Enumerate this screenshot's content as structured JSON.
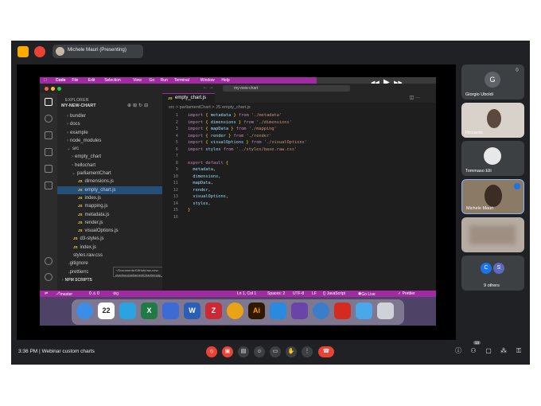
{
  "meeting": {
    "presenter_label": "Michele Mauri (Presenting)",
    "time": "3:36 PM",
    "title": "Webinar custom charts",
    "participants_badge": "13"
  },
  "participants": [
    {
      "name": "Giorgio Uboldi",
      "initial": "G",
      "avatar_color": "#5f6368"
    },
    {
      "name": "Riccardo",
      "initial": "",
      "avatar_color": ""
    },
    {
      "name": "Tommaso Elli",
      "initial": "",
      "avatar_color": ""
    },
    {
      "name": "Michele Mauri",
      "initial": "",
      "avatar_color": ""
    },
    {
      "name": "",
      "initial": "",
      "avatar_color": ""
    },
    {
      "name": "9 others",
      "initial": "C",
      "initial2": "S",
      "avatar_color": "#1a73e8",
      "avatar_color2": "#5c6bc0"
    }
  ],
  "mac_menu": [
    "Code",
    "File",
    "Edit",
    "Selection",
    "View",
    "Go",
    "Run",
    "Terminal",
    "Window",
    "Help"
  ],
  "player": {
    "elapsed": "03:24",
    "remaining": "18:57",
    "progress": 0.2
  },
  "vscode": {
    "command_center": "my-new-chart",
    "explorer_title": "EXPLORER",
    "project": "MY-NEW-CHART",
    "tree": [
      {
        "label": "bundler",
        "indent": 1,
        "js": false
      },
      {
        "label": "docs",
        "indent": 1,
        "js": false
      },
      {
        "label": "example",
        "indent": 1,
        "js": false
      },
      {
        "label": "node_modules",
        "indent": 1,
        "js": false
      },
      {
        "label": "src",
        "indent": 1,
        "js": false
      },
      {
        "label": "empty_chart",
        "indent": 2,
        "js": false
      },
      {
        "label": "hellochart",
        "indent": 2,
        "js": false
      },
      {
        "label": "parliamentChart",
        "indent": 2,
        "js": false
      },
      {
        "label": "dimensions.js",
        "indent": 3,
        "js": true
      },
      {
        "label": "empty_chart.js",
        "indent": 3,
        "js": true,
        "selected": true
      },
      {
        "label": "index.js",
        "indent": 3,
        "js": true
      },
      {
        "label": "mapping.js",
        "indent": 3,
        "js": true
      },
      {
        "label": "metadata.js",
        "indent": 3,
        "js": true
      },
      {
        "label": "render.js",
        "indent": 3,
        "js": true
      },
      {
        "label": "visualOptions.js",
        "indent": 3,
        "js": true
      },
      {
        "label": "d3-styles.js",
        "indent": 2,
        "js": true
      },
      {
        "label": "index.js",
        "indent": 2,
        "js": true
      },
      {
        "label": "styles.raw.css",
        "indent": 2,
        "js": false
      },
      {
        "label": ".gitignore",
        "indent": 1,
        "js": false
      },
      {
        "label": ".prettierrc",
        "indent": 1,
        "js": false
      },
      {
        "label": "NPM SCRIPTS",
        "indent": 0,
        "js": false
      }
    ],
    "tooltip": "~/Documents/GitHub/raw-new-chart/src/parliamentChart/empty_chart.js",
    "tab": "empty_chart.js",
    "breadcrumb": "src > parliamentChart > JS empty_chart.js",
    "code_lines": [
      "import { metadata } from './metadata'",
      "import { dimensions } from './dimensions'",
      "import { mapData } from './mapping'",
      "import { render } from './render'",
      "import { visualOptions } from './visualOptions'",
      "import styles from '../styles/base.raw.css'",
      "",
      "export default {",
      "  metadata,",
      "  dimensions,",
      "  mapData,",
      "  render,",
      "  visualOptions,",
      "  styles,",
      "}",
      ""
    ],
    "status": {
      "branch": "master",
      "problems": "0 ⚠ 0",
      "warnings": "0",
      "position": "Ln 1, Col 1",
      "spaces": "Spaces: 2",
      "encoding": "UTF-8",
      "eol": "LF",
      "language": "{} JavaScript",
      "golive": "Go Live",
      "prettier": "✓ Prettier"
    }
  },
  "dock_apps": [
    {
      "name": "finder-icon",
      "color": "#3b8ee8",
      "glyph": ""
    },
    {
      "name": "calendar-icon",
      "color": "#ffffff",
      "glyph": "22"
    },
    {
      "name": "telegram-icon",
      "color": "#2aa3e0",
      "glyph": ""
    },
    {
      "name": "excel-icon",
      "color": "#1f7a45",
      "glyph": "X"
    },
    {
      "name": "keynote-icon",
      "color": "#3d6bd6",
      "glyph": ""
    },
    {
      "name": "word-icon",
      "color": "#2b5fb7",
      "glyph": "W"
    },
    {
      "name": "zotero-icon",
      "color": "#cc2936",
      "glyph": "Z"
    },
    {
      "name": "chrome-icon",
      "color": "#e8a317",
      "glyph": ""
    },
    {
      "name": "illustrator-icon",
      "color": "#2e1800",
      "glyph": "Ai"
    },
    {
      "name": "vscode-icon",
      "color": "#2a8ae0",
      "glyph": ""
    },
    {
      "name": "github-desktop-icon",
      "color": "#6a44a8",
      "glyph": ""
    },
    {
      "name": "quicktime-icon",
      "color": "#3a7ec9",
      "glyph": ""
    },
    {
      "name": "acrobat-icon",
      "color": "#d42b20",
      "glyph": ""
    },
    {
      "name": "folder-icon",
      "color": "#4aa7e9",
      "glyph": ""
    },
    {
      "name": "trash-icon",
      "color": "#cfd3d8",
      "glyph": ""
    }
  ],
  "colors": {
    "accent": "#a12aa3",
    "meet_bg": "#202124",
    "end_call": "#ea4335"
  }
}
